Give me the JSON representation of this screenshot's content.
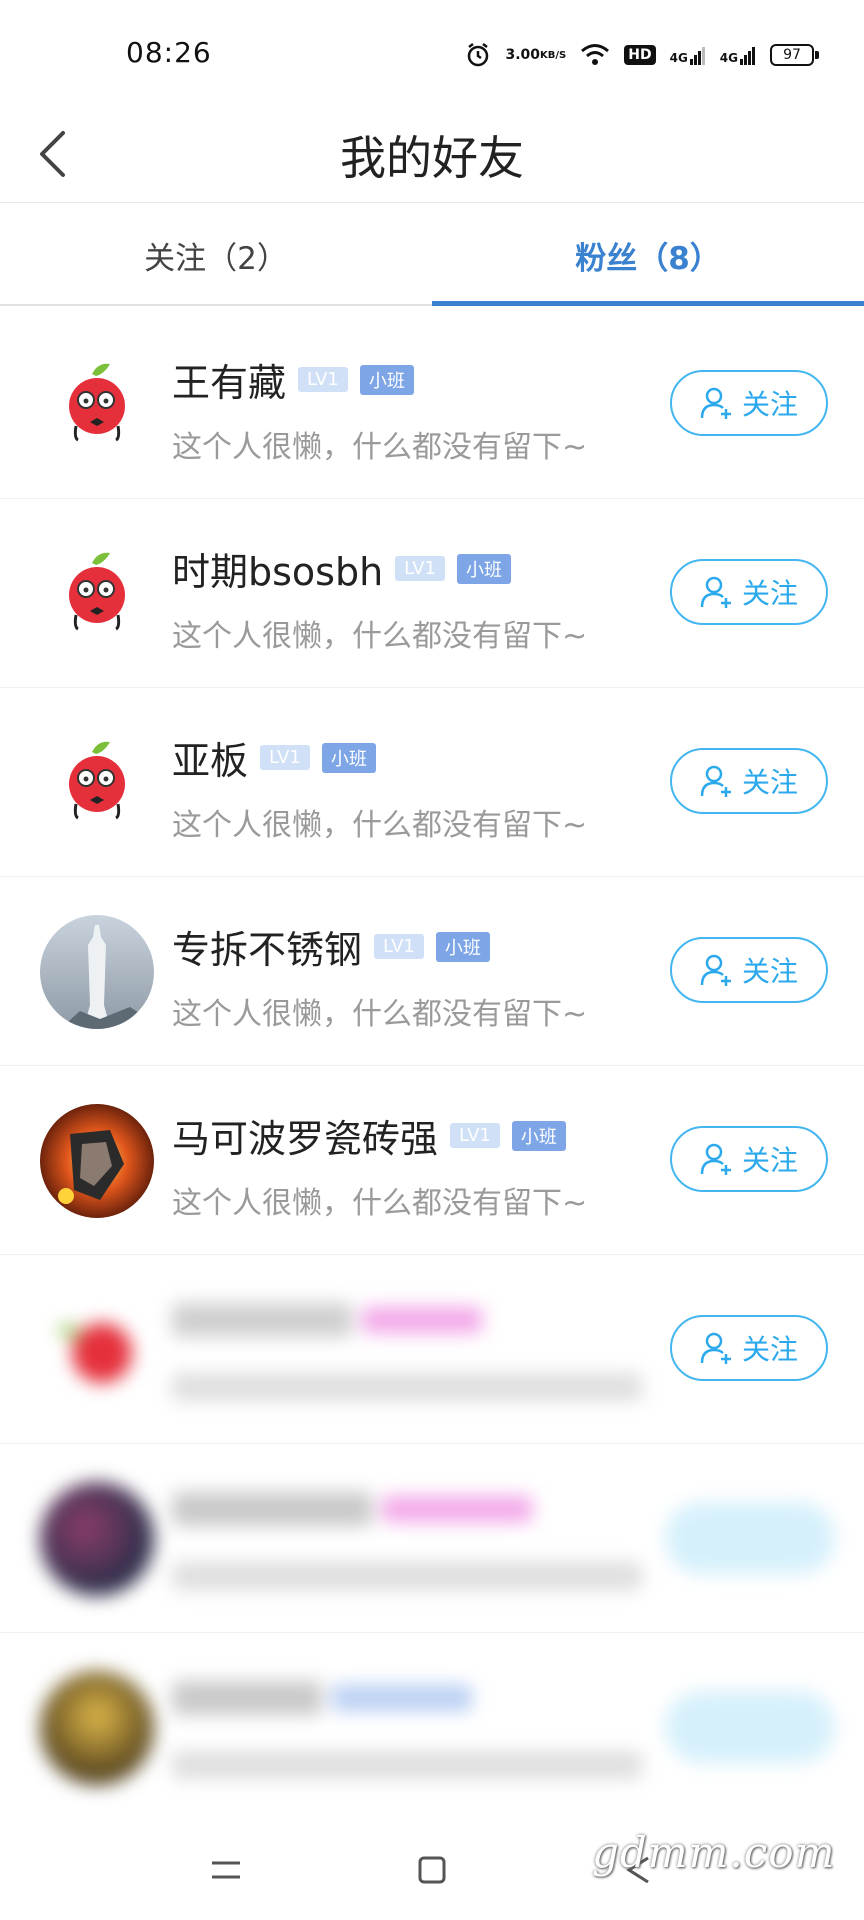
{
  "status_bar": {
    "time": "08:26",
    "net_speed_value": "3.00",
    "net_speed_unit": "KB/S",
    "hd_label": "HD",
    "signal1_label": "4G",
    "signal2_label": "4G",
    "battery": "97"
  },
  "header": {
    "title": "我的好友"
  },
  "tabs": [
    {
      "label": "关注（2）",
      "active": false
    },
    {
      "label": "粉丝（8）",
      "active": true
    }
  ],
  "fans": [
    {
      "name": "王有藏",
      "level": "LV1",
      "class": "小班",
      "bio": "这个人很懒，什么都没有留下~",
      "follow_label": "关注",
      "avatar_icon": "lychee-mascot-icon"
    },
    {
      "name": "时期bsosbh",
      "level": "LV1",
      "class": "小班",
      "bio": "这个人很懒，什么都没有留下~",
      "follow_label": "关注",
      "avatar_icon": "lychee-mascot-icon"
    },
    {
      "name": "亚板",
      "level": "LV1",
      "class": "小班",
      "bio": "这个人很懒，什么都没有留下~",
      "follow_label": "关注",
      "avatar_icon": "lychee-mascot-icon"
    },
    {
      "name": "专拆不锈钢",
      "level": "LV1",
      "class": "小班",
      "bio": "这个人很懒，什么都没有留下~",
      "follow_label": "关注",
      "avatar_icon": "statue-photo-icon"
    },
    {
      "name": "马可波罗瓷砖强",
      "level": "LV1",
      "class": "小班",
      "bio": "这个人很懒，什么都没有留下~",
      "follow_label": "关注",
      "avatar_icon": "game-art-icon"
    }
  ],
  "blurred_rows": {
    "follow_label": "关注"
  },
  "watermark": "gdmm.com",
  "colors": {
    "accent": "#3a82cf",
    "follow": "#2ba9ec",
    "mascot_red": "#e5303c"
  }
}
